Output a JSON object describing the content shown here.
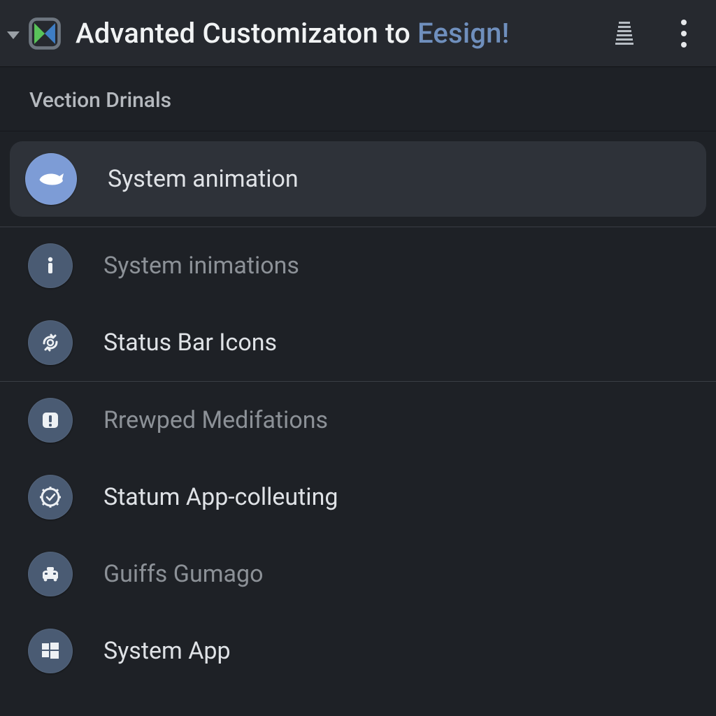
{
  "header": {
    "title_main": "Advanted Customizaton to",
    "title_accent": "Eesign!"
  },
  "section": {
    "label": "Vection Drinals"
  },
  "items": [
    {
      "icon": "whale",
      "label": "System animation",
      "selected": true,
      "muted": false
    },
    {
      "icon": "info",
      "label": "System inimations",
      "selected": false,
      "muted": true
    },
    {
      "icon": "loop",
      "label": "Status Bar Icons",
      "selected": false,
      "muted": false
    },
    {
      "icon": "alert",
      "label": "Rrewped Medifations",
      "selected": false,
      "muted": true
    },
    {
      "icon": "gear",
      "label": "Statum App-colleuting",
      "selected": false,
      "muted": false
    },
    {
      "icon": "car",
      "label": "Guiffs Gumago",
      "selected": false,
      "muted": true
    },
    {
      "icon": "windows",
      "label": "System App",
      "selected": false,
      "muted": false
    }
  ]
}
